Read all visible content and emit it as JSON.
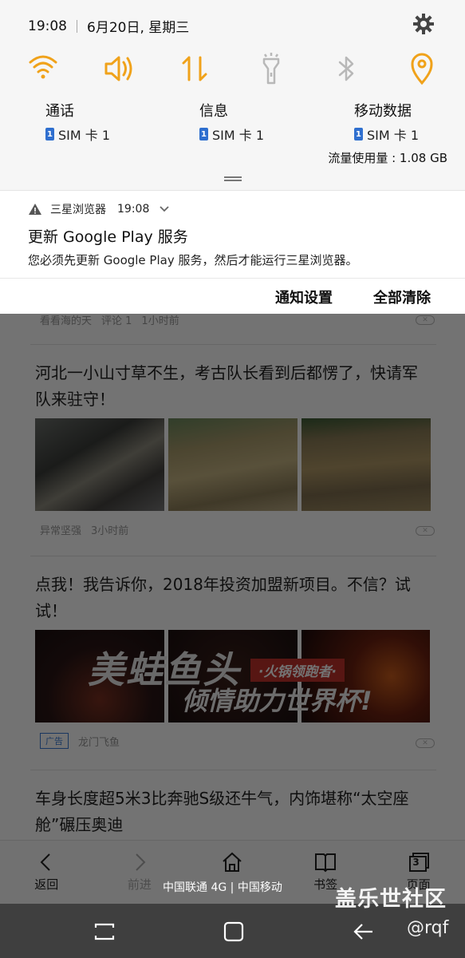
{
  "status_bar": {
    "time": "19:08",
    "date": "6月20日, 星期三"
  },
  "quick_settings": {
    "toggles": [
      "wifi-icon",
      "sound-icon",
      "mobile-data-icon",
      "flashlight-icon",
      "bluetooth-icon",
      "location-icon"
    ],
    "accent_color": "#f0a21a",
    "inactive_color": "#b8b8b8"
  },
  "sim_settings": [
    {
      "title": "通话",
      "sim_badge": "1",
      "sim_label": "SIM 卡 1"
    },
    {
      "title": "信息",
      "sim_badge": "1",
      "sim_label": "SIM 卡 1"
    },
    {
      "title": "移动数据",
      "sim_badge": "1",
      "sim_label": "SIM 卡 1"
    }
  ],
  "data_usage": "流量使用量 : 1.08 GB",
  "notification": {
    "app": "三星浏览器",
    "time": "19:08",
    "title": "更新 Google Play 服务",
    "body": "您必须先更新 Google Play 服务，然后才能运行三星浏览器。"
  },
  "actions": {
    "settings": "通知设置",
    "clear_all": "全部清除"
  },
  "feed": {
    "item0_meta": {
      "source": "看看海的天",
      "comments": "评论 1",
      "time": "1小时前"
    },
    "item1": {
      "headline": "河北一小山寸草不生，考古队长看到后都愣了，快请军队来驻守！",
      "source": "异常坚强",
      "time": "3小时前"
    },
    "item2": {
      "headline": "点我！我告诉你，2018年投资加盟新项目。不信？试试！",
      "ad_label": "广告",
      "source": "龙门飞鱼",
      "banner_text1": "美蛙鱼头",
      "banner_tag": "·火锅领跑者·",
      "banner_text2": "倾情助力世界杯!"
    },
    "item3": {
      "headline": "车身长度超5米3比奔驰S级还牛气，内饰堪称“太空座舱”碾压奥迪"
    }
  },
  "toolbar": {
    "back": "返回",
    "forward": "前进",
    "home": "",
    "bookmarks": "书签",
    "tabs": "页面",
    "tab_count": "3"
  },
  "carrier": "中国联通 4G | 中国移动",
  "watermark": {
    "line1": "盖乐世社区",
    "line2": "@rqf"
  }
}
